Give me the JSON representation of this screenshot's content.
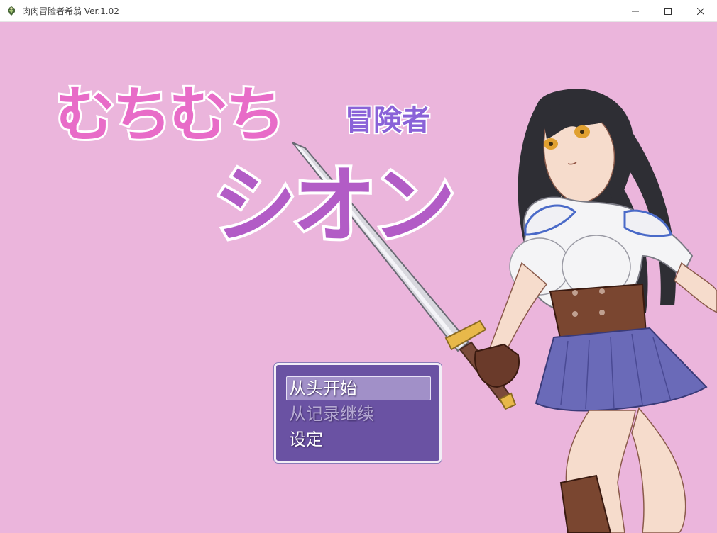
{
  "window": {
    "title": "肉肉冒险者希翁 Ver.1.02",
    "icon": "game-icon"
  },
  "logo": {
    "line1": "むちむち",
    "line1_suffix": "冒険者",
    "line2": "シオン"
  },
  "menu": {
    "items": [
      {
        "label": "从头开始",
        "selected": true,
        "enabled": true
      },
      {
        "label": "从记录继续",
        "selected": false,
        "enabled": false
      },
      {
        "label": "设定",
        "selected": false,
        "enabled": true
      }
    ]
  },
  "colors": {
    "background": "#ebb5dc",
    "logo_pink": "#e86cc8",
    "logo_purple": "#b25cc6",
    "logo_blue_text": "#8a62d8",
    "menu_bg": "#6a52a3"
  }
}
